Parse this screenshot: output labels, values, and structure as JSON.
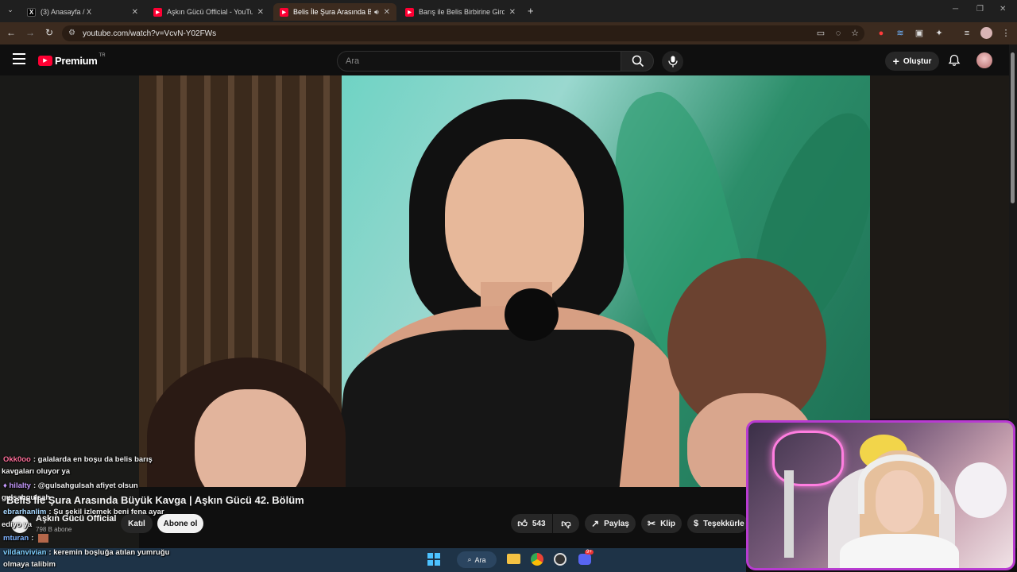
{
  "browser": {
    "tabs": [
      {
        "title": "(3) Anasayfa / X",
        "favicon": "x-icon",
        "active": false
      },
      {
        "title": "Aşkın Gücü Official - YouTube",
        "favicon": "youtube-icon",
        "active": false
      },
      {
        "title": "Belis İle Şura Arasında Büyü",
        "favicon": "youtube-icon",
        "active": true
      },
      {
        "title": "Barış ile Belis Birbirine Girdi | Aş",
        "favicon": "youtube-icon",
        "active": false
      }
    ],
    "url": "youtube.com/watch?v=VcvN-Y02FWs",
    "new_tab_label": "+"
  },
  "youtube": {
    "logo_text": "Premium",
    "logo_region": "TR",
    "search_placeholder": "Ara",
    "create_label": "Oluştur",
    "video": {
      "title": "Belis İle Şura Arasında Büyük Kavga | Aşkın Gücü 42. Bölüm",
      "channel": "Aşkın Gücü Official",
      "subscribers": "798 B abone",
      "join_label": "Katıl",
      "subscribe_label": "Abone ol",
      "likes": "543",
      "share_label": "Paylaş",
      "clip_label": "Klip",
      "thanks_label": "Teşekkürle"
    }
  },
  "chat": [
    {
      "nick": "Okk0oo",
      "nick_color": "#ff6f9a",
      "text": ": galalarda en boşu da belis barış"
    },
    {
      "nick": "",
      "nick_color": "#ffffff",
      "text": "kavgaları oluyor ya"
    },
    {
      "nick": "hilalty",
      "nick_color": "#c79bff",
      "text": ": @gulsahgulsah afiyet olsun"
    },
    {
      "nick": "ebrarhanlim",
      "nick_color": "#a8d8ff",
      "text": ": Şu şekil izlemek beni fena ayar"
    },
    {
      "nick": "mturan",
      "nick_color": "#7fb3ff",
      "text": ":"
    },
    {
      "nick": "vildanvivian",
      "nick_color": "#7fd0ff",
      "text": ": keremin boşluğa atılan yumruğu"
    },
    {
      "nick": "",
      "nick_color": "#ffffff",
      "text": "olmaya talibim"
    }
  ],
  "overlay_fragments": {
    "gulsa": "gulsahgulsah",
    "edi": "ediyo ya"
  },
  "taskbar": {
    "search_label": "Ara",
    "badge": "9+"
  },
  "colors": {
    "chrome_active": "#3c2b1f",
    "yt_red": "#ff0033",
    "webcam_border": "#b83bd1"
  }
}
